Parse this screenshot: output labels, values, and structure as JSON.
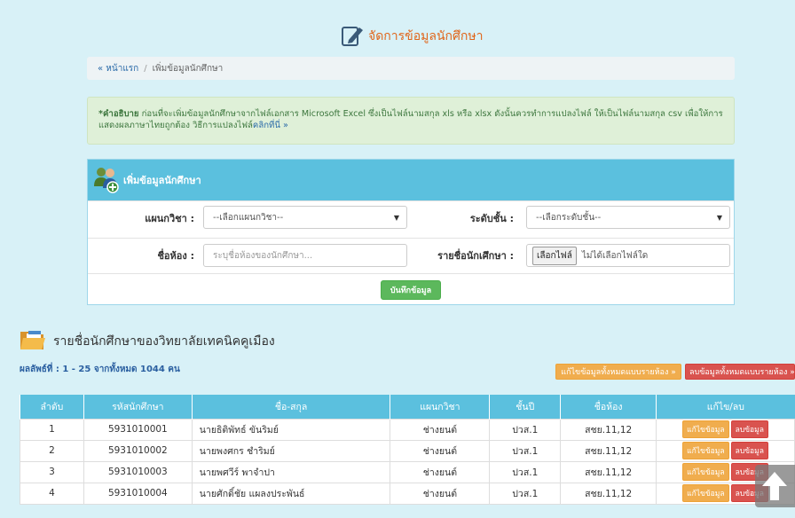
{
  "page_title": "จัดการข้อมูลนักศึกษา",
  "breadcrumb": {
    "home": "« หน้าแรก",
    "separator": "/",
    "current": "เพิ่มข้อมูลนักศึกษา"
  },
  "alert": {
    "bold": "*คำอธิบาย",
    "text": " ก่อนที่จะเพิ่มข้อมูลนักศึกษาจากไฟล์เอกสาร Microsoft Excel ซึ่งเป็นไฟล์นามสกุล xls หรือ xlsx ดังนั้นควรทำการแปลงไฟล์ ให้เป็นไฟล์นามสกุล csv เพื่อให้การแสดงผลภาษาไทยถูกต้อง วิธีการแปลงไฟล์",
    "link": "คลิกที่นี่ »"
  },
  "panel": {
    "title": "เพิ่มข้อมูลนักศึกษา",
    "dept_label": "แผนกวิชา :",
    "dept_value": "--เลือกแผนกวิชา--",
    "level_label": "ระดับชั้น :",
    "level_value": "--เลือกระดับชั้น--",
    "room_label": "ชื่อห้อง :",
    "room_placeholder": "ระบุชื่อห้องของนักศึกษา...",
    "file_label": "รายชื่อนักเศึกษา :",
    "file_button": "เลือกไฟล์",
    "file_status": "ไม่ได้เลือกไฟล์ใด",
    "save_button": "บันทึกข้อมูล"
  },
  "list": {
    "title": "รายชื่อนักศึกษาของวิทยาลัยเทคนิคคูเมือง",
    "result": "ผลลัพธ์ที่ : 1 - 25 จากทั้งหมด 1044 คน",
    "edit_all": "แก้ไขข้อมูลทั้งหมดแบบรายห้อง »",
    "delete_all": "ลบข้อมูลทั้งหมดแบบรายห้อง »"
  },
  "table": {
    "headers": [
      "ลำดับ",
      "รหัสนักศึกษา",
      "ชื่อ-สกุล",
      "แผนกวิชา",
      "ชั้นปี",
      "ชื่อห้อง",
      "แก้ไข/ลบ"
    ],
    "edit_label": "แก้ไขข้อมูล",
    "delete_label": "ลบข้อมูล",
    "rows": [
      [
        "1",
        "5931010001",
        "นายธิติพัทธ์ ขันริมย์",
        "ช่างยนต์",
        "ปวส.1",
        "สชย.11,12"
      ],
      [
        "2",
        "5931010002",
        "นายพงศกร ชำริมย์",
        "ช่างยนต์",
        "ปวส.1",
        "สชย.11,12"
      ],
      [
        "3",
        "5931010003",
        "นายพศวีร์ พาจำปา",
        "ช่างยนต์",
        "ปวส.1",
        "สชย.11,12"
      ],
      [
        "4",
        "5931010004",
        "นายศักดิ์ชัย แผลงประพันธ์",
        "ช่างยนต์",
        "ปวส.1",
        "สชย.11,12"
      ]
    ]
  },
  "colors": {
    "accent": "#5bc0de",
    "title": "#e0661b",
    "success": "#5cb85c",
    "warning": "#f0ad4e",
    "danger": "#d9534f"
  }
}
